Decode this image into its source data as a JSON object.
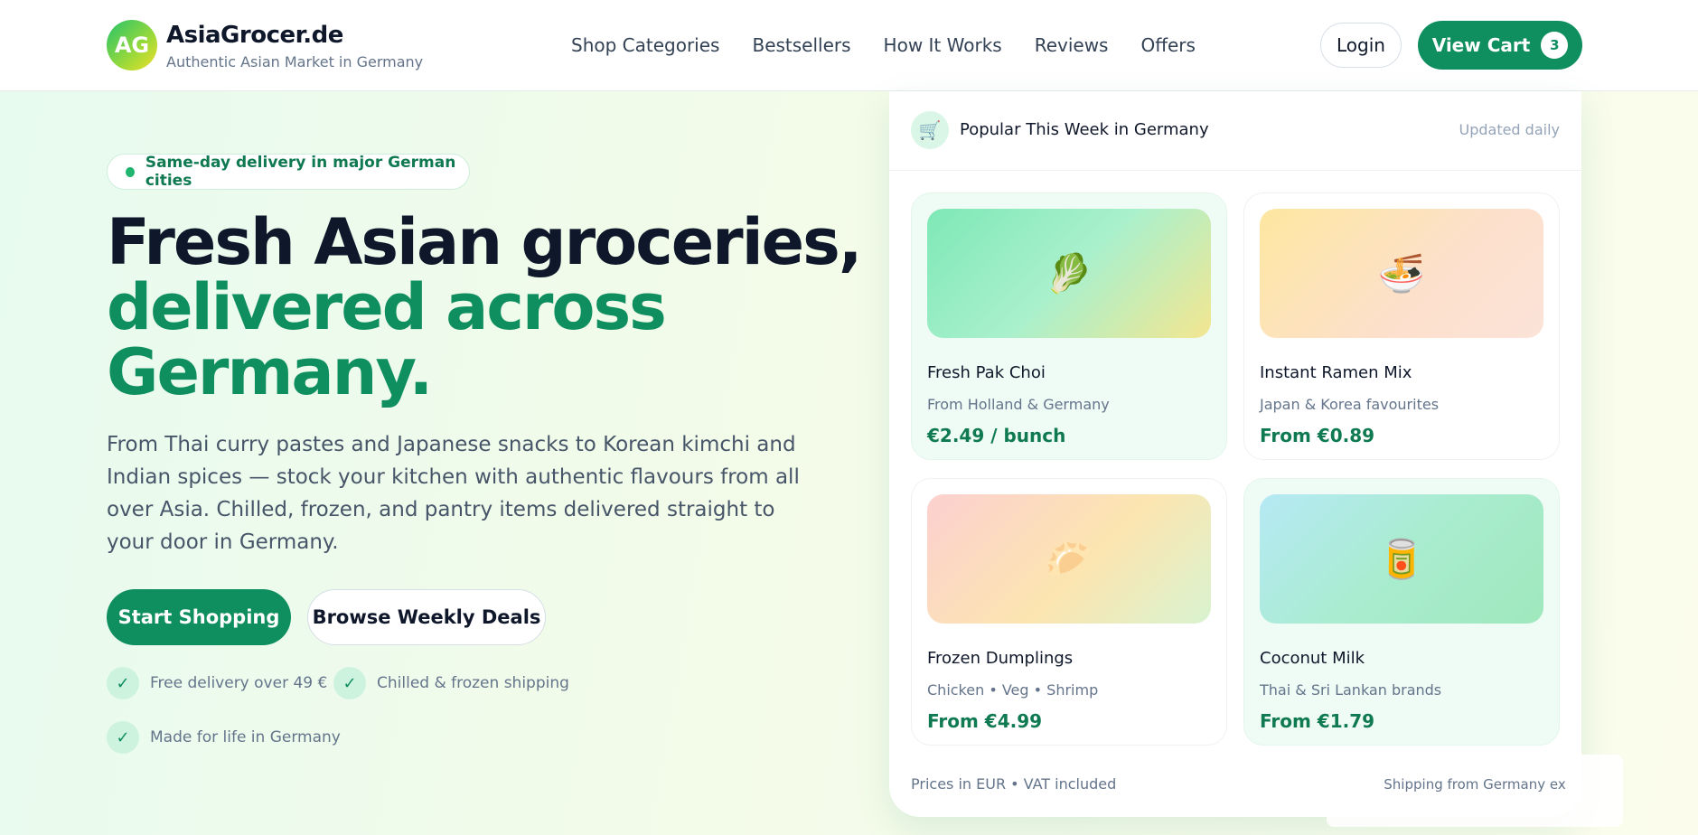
{
  "brand": {
    "logo_text": "AG",
    "name": "AsiaGrocer.de",
    "tagline": "Authentic Asian Market in Germany"
  },
  "nav": {
    "items": [
      "Shop Categories",
      "Bestsellers",
      "How It Works",
      "Reviews",
      "Offers"
    ]
  },
  "header": {
    "login_label": "Login",
    "cart_label": "View Cart",
    "cart_count": "3"
  },
  "hero": {
    "badge": "Same-day delivery in major German cities",
    "title_line1": "Fresh Asian groceries,",
    "title_line2": "delivered across Germany.",
    "description": "From Thai curry pastes and Japanese snacks to Korean kimchi and Indian spices — stock your kitchen with authentic flavours from all over Asia. Chilled, frozen, and pantry items delivered straight to your door in Germany.",
    "primary_cta": "Start Shopping",
    "secondary_cta": "Browse Weekly Deals",
    "perks": [
      "Free delivery over 49 €",
      "Chilled & frozen shipping",
      "Made for life in Germany"
    ]
  },
  "panel": {
    "icon": "shopping-cart-icon",
    "title": "Popular This Week in Germany",
    "updated": "Updated daily",
    "footer": "Prices in EUR • VAT included",
    "products": [
      {
        "name": "Fresh Pak Choi",
        "sub": "From Holland & Germany",
        "price": "€2.49 / bunch",
        "emoji": "🥬",
        "icon": "leafy-greens-icon"
      },
      {
        "name": "Instant Ramen Mix",
        "sub": "Japan & Korea favourites",
        "price": "From €0.89",
        "emoji": "🍜",
        "icon": "noodle-bowl-icon"
      },
      {
        "name": "Frozen Dumplings",
        "sub": "Chicken • Veg • Shrimp",
        "price": "From €4.99",
        "emoji": "🥟",
        "icon": "dumpling-icon"
      },
      {
        "name": "Coconut Milk",
        "sub": "Thai & Sri Lankan brands",
        "price": "From €1.79",
        "emoji": "🥫",
        "icon": "canned-food-icon"
      }
    ]
  },
  "shipping_note": "Shipping from Germany ex"
}
